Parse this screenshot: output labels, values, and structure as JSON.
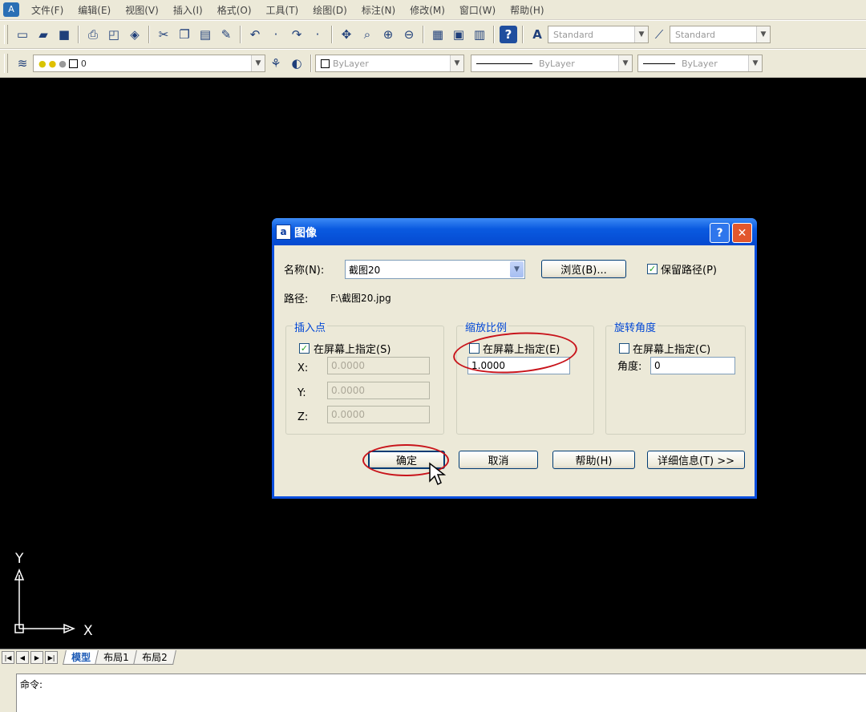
{
  "menubar": {
    "items": [
      "文件(F)",
      "编辑(E)",
      "视图(V)",
      "插入(I)",
      "格式(O)",
      "工具(T)",
      "绘图(D)",
      "标注(N)",
      "修改(M)",
      "窗口(W)",
      "帮助(H)"
    ]
  },
  "toolbar_styles": {
    "text_style": "Standard",
    "dim_style": "Standard"
  },
  "layers_toolbar": {
    "current_layer": "0"
  },
  "properties_toolbar": {
    "color": "ByLayer",
    "linetype": "ByLayer",
    "lineweight": "ByLayer"
  },
  "ucs": {
    "x_label": "X",
    "y_label": "Y"
  },
  "layout_tabs": [
    "模型",
    "布局1",
    "布局2"
  ],
  "command": {
    "prompt": "命令:"
  },
  "dialog": {
    "title": "图像",
    "name_label": "名称(N):",
    "name_value": "截图20",
    "browse_label": "浏览(B)...",
    "keep_path_label": "保留路径(P)",
    "keep_path_checked": true,
    "path_label": "路径:",
    "path_value": "F:\\截图20.jpg",
    "insertion": {
      "title": "插入点",
      "specify_label": "在屏幕上指定(S)",
      "specify_checked": true,
      "x_label": "X:",
      "x_value": "0.0000",
      "y_label": "Y:",
      "y_value": "0.0000",
      "z_label": "Z:",
      "z_value": "0.0000"
    },
    "scale": {
      "title": "缩放比例",
      "specify_label": "在屏幕上指定(E)",
      "specify_checked": false,
      "value": "1.0000"
    },
    "rotation": {
      "title": "旋转角度",
      "specify_label": "在屏幕上指定(C)",
      "specify_checked": false,
      "angle_label": "角度:",
      "angle_value": "0"
    },
    "ok_label": "确定",
    "cancel_label": "取消",
    "help_label": "帮助(H)",
    "details_label": "详细信息(T) >>"
  }
}
